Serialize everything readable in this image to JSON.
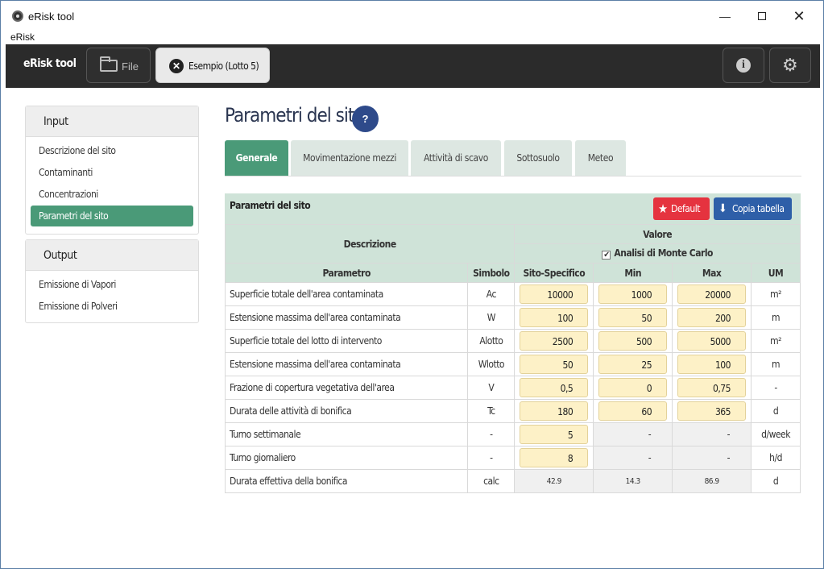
{
  "window": {
    "title": "eRisk tool",
    "min": "—",
    "close": "✕"
  },
  "menubar": {
    "item": "eRisk"
  },
  "header": {
    "brand": "eRisk tool",
    "file_label": "File",
    "open_tab": "Esempio (Lotto 5)",
    "info_icon": "i",
    "settings_icon": "⚙"
  },
  "sidebar": {
    "input": {
      "title": "Input",
      "items": [
        {
          "label": "Descrizione del sito"
        },
        {
          "label": "Contaminanti"
        },
        {
          "label": "Concentrazioni"
        },
        {
          "label": "Parametri del sito"
        }
      ]
    },
    "output": {
      "title": "Output",
      "items": [
        {
          "label": "Emissione di Vapori"
        },
        {
          "label": "Emissione di Polveri"
        }
      ]
    }
  },
  "main": {
    "title": "Parametri del sito",
    "help": "?",
    "tabs": [
      {
        "label": "Generale"
      },
      {
        "label": "Movimentazione mezzi"
      },
      {
        "label": "Attività di scavo"
      },
      {
        "label": "Sottosuolo"
      },
      {
        "label": "Meteo"
      }
    ]
  },
  "table": {
    "title": "Parametri del sito",
    "default_btn": "Default",
    "copy_btn": "Copia tabella",
    "head_descrizione": "Descrizione",
    "head_valore": "Valore",
    "monte_carlo": "Analisi di Monte Carlo",
    "columns": {
      "parametro": "Parametro",
      "simbolo": "Simbolo",
      "sito": "Sito-Specifico",
      "min": "Min",
      "max": "Max",
      "um": "UM"
    },
    "rows": [
      {
        "desc": "Superficie totale dell'area contaminata",
        "sym": "Ac",
        "sito": "10000",
        "min": "1000",
        "max": "20000",
        "um": "m²"
      },
      {
        "desc": "Estensione massima dell'area contaminata",
        "sym": "W",
        "sito": "100",
        "min": "50",
        "max": "200",
        "um": "m"
      },
      {
        "desc": "Superficie totale del lotto di intervento",
        "sym": "Alotto",
        "sito": "2500",
        "min": "500",
        "max": "5000",
        "um": "m²"
      },
      {
        "desc": "Estensione massima dell'area contaminata",
        "sym": "Wlotto",
        "sito": "50",
        "min": "25",
        "max": "100",
        "um": "m"
      },
      {
        "desc": "Frazione di copertura vegetativa dell'area",
        "sym": "V",
        "sito": "0,5",
        "min": "0",
        "max": "0,75",
        "um": "-"
      },
      {
        "desc": "Durata delle attività di bonifica",
        "sym": "Tc",
        "sito": "180",
        "min": "60",
        "max": "365",
        "um": "d"
      },
      {
        "desc": "Turno settimanale",
        "sym": "-",
        "sito": "5",
        "min": "-",
        "max": "-",
        "um": "d/week"
      },
      {
        "desc": "Turno giornaliero",
        "sym": "-",
        "sito": "8",
        "min": "-",
        "max": "-",
        "um": "h/d"
      },
      {
        "desc": "Durata effettiva della bonifica",
        "sym": "calc",
        "sito": "42.9",
        "min": "14.3",
        "max": "86.9",
        "um": "d"
      }
    ]
  }
}
